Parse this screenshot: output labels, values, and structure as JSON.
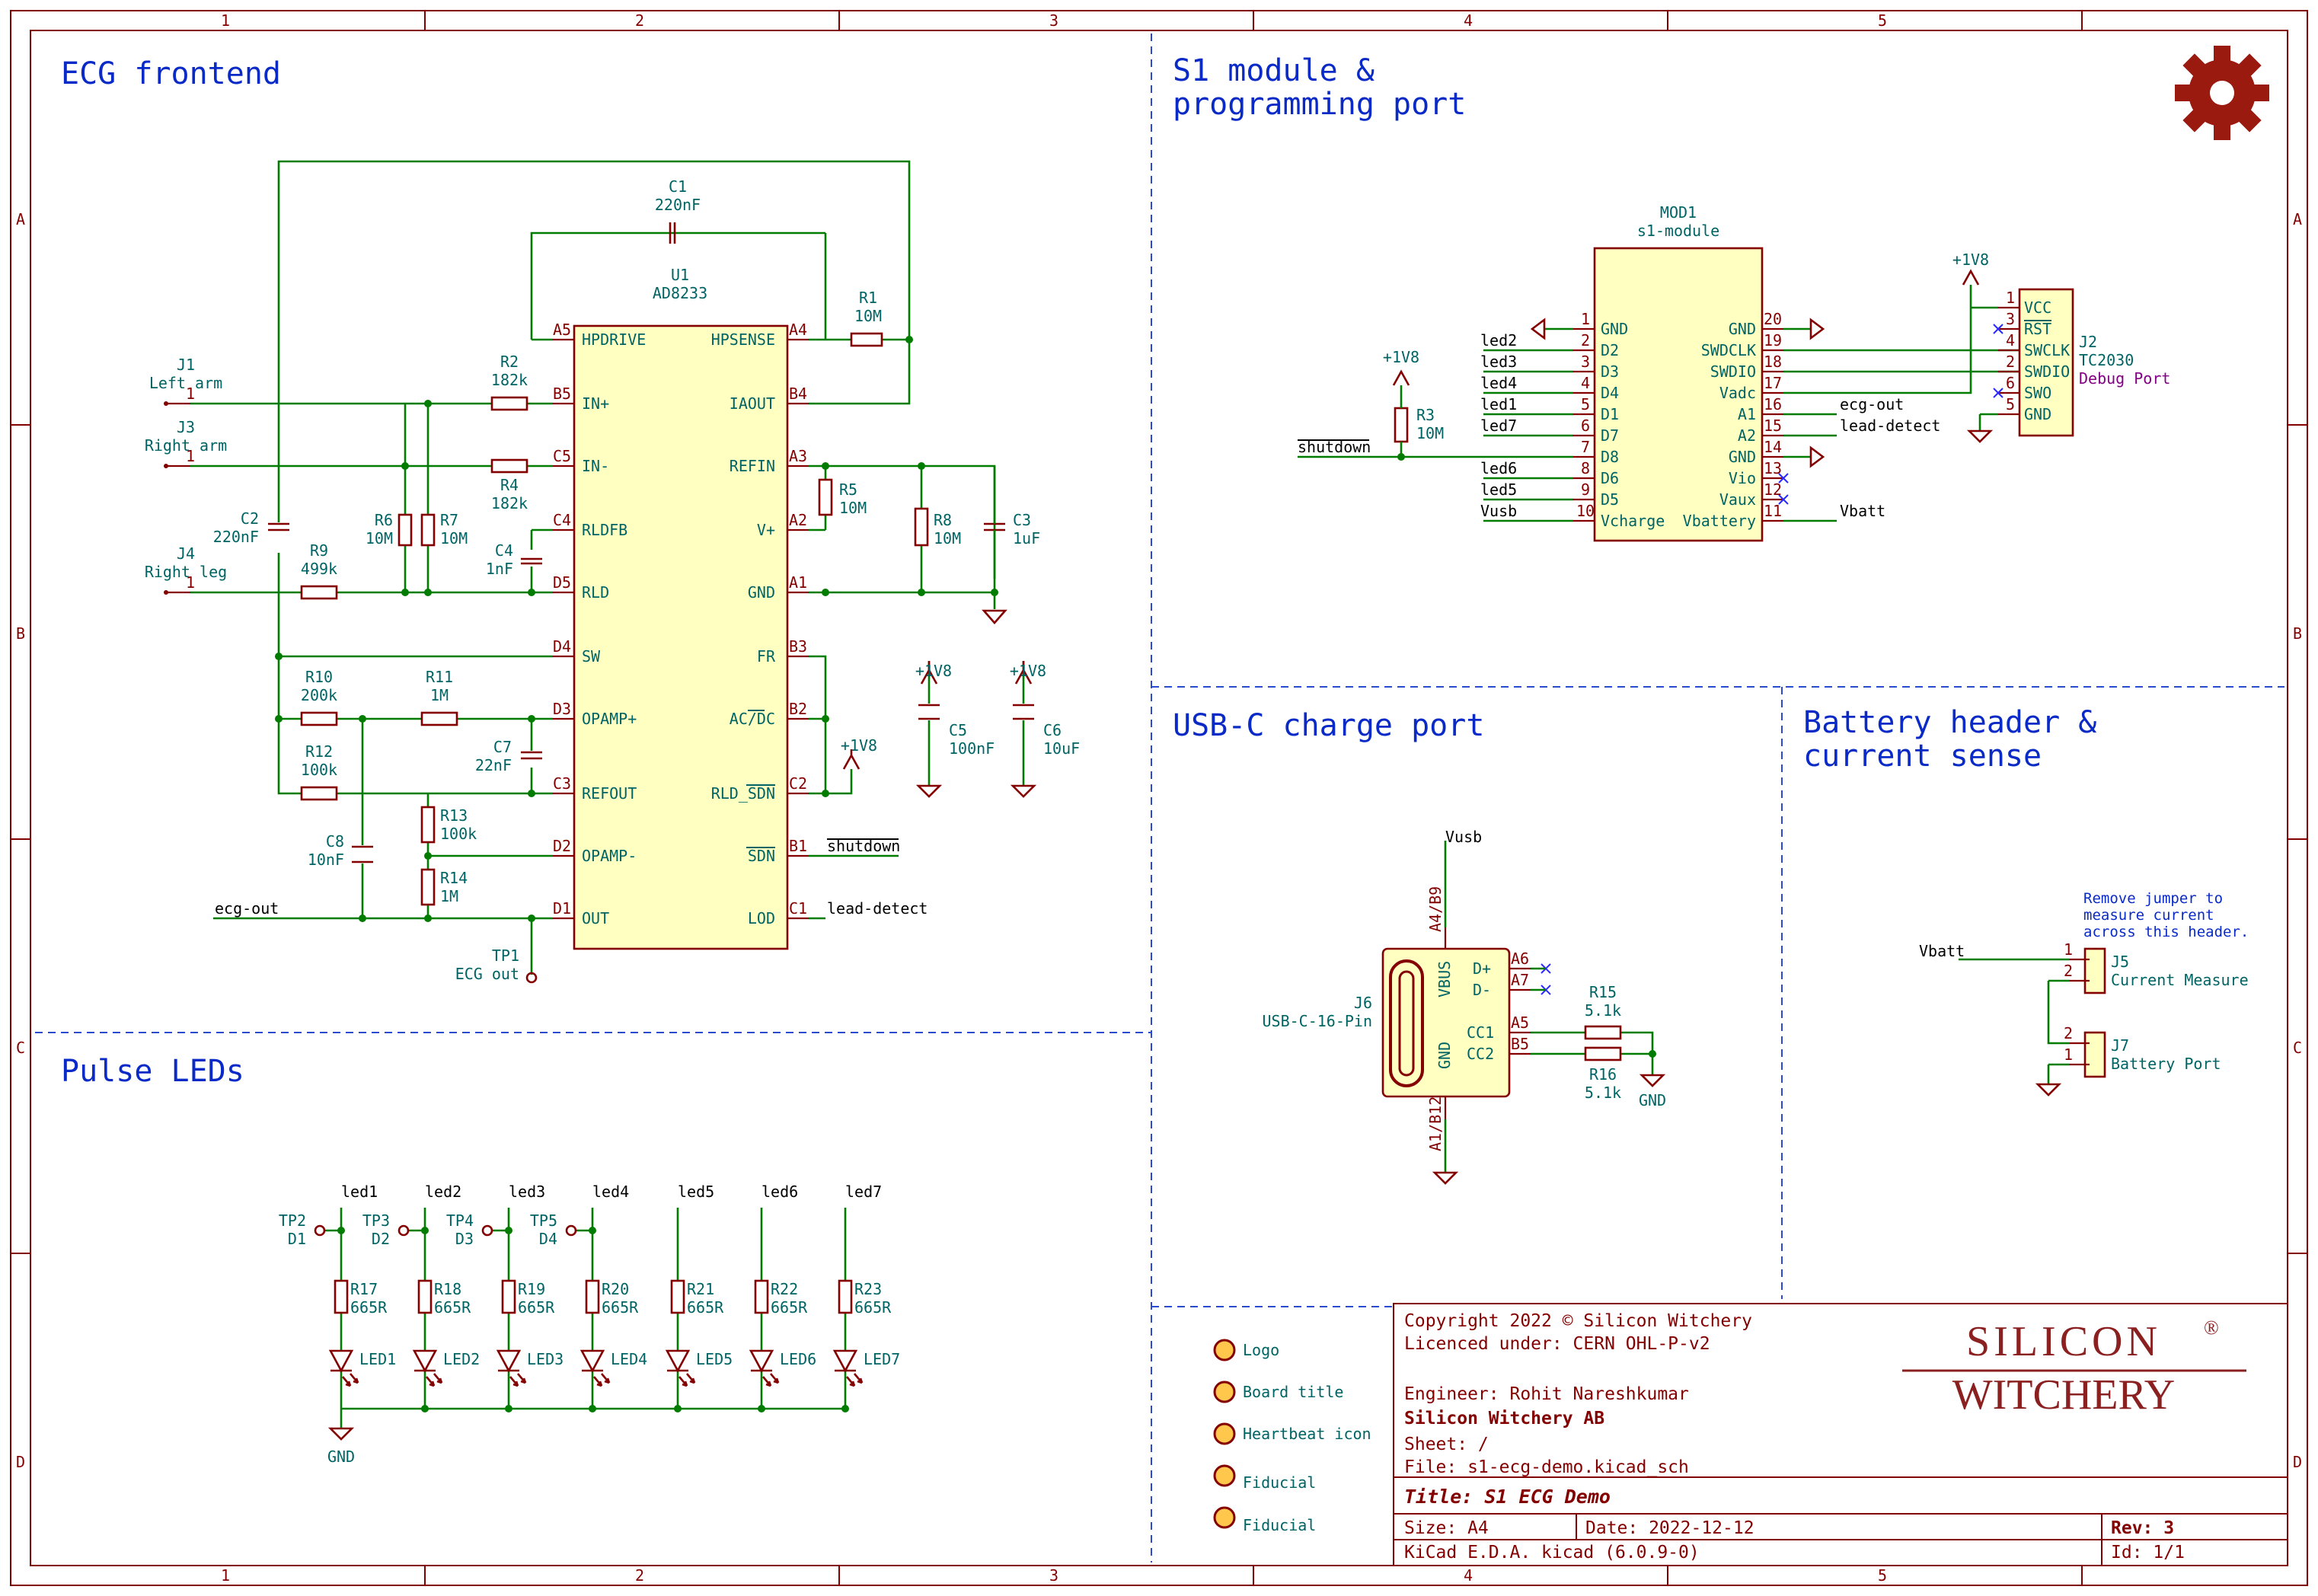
{
  "sections": {
    "ecg": "ECG frontend",
    "s1_line1": "S1 module &",
    "s1_line2": "programming port",
    "pulse": "Pulse LEDs",
    "usb": "USB-C charge port",
    "batt_line1": "Battery header &",
    "batt_line2": "current sense"
  },
  "grid_cols": [
    "1",
    "2",
    "3",
    "4",
    "5"
  ],
  "grid_rows": [
    "A",
    "B",
    "C",
    "D"
  ],
  "u1": {
    "ref": "U1",
    "value": "AD8233",
    "left_pins": [
      {
        "num": "A5",
        "name": "HPDRIVE"
      },
      {
        "num": "B5",
        "name": "IN+"
      },
      {
        "num": "C5",
        "name": "IN-"
      },
      {
        "num": "C4",
        "name": "RLDFB"
      },
      {
        "num": "D5",
        "name": "RLD"
      },
      {
        "num": "D4",
        "name": "SW"
      },
      {
        "num": "D3",
        "name": "OPAMP+"
      },
      {
        "num": "C3",
        "name": "REFOUT"
      },
      {
        "num": "D2",
        "name": "OPAMP-"
      },
      {
        "num": "D1",
        "name": "OUT"
      }
    ],
    "right_pins": [
      {
        "num": "A4",
        "name": "HPSENSE"
      },
      {
        "num": "B4",
        "name": "IAOUT"
      },
      {
        "num": "A3",
        "name": "REFIN"
      },
      {
        "num": "A2",
        "name": "V+"
      },
      {
        "num": "A1",
        "name": "GND"
      },
      {
        "num": "B3",
        "name": "FR"
      },
      {
        "num": "B2",
        "name": "AC/DC"
      },
      {
        "num": "C2",
        "name": "RLD_SDN"
      },
      {
        "num": "B1",
        "name": "SDN"
      },
      {
        "num": "C1",
        "name": "LOD"
      }
    ]
  },
  "ecg_parts": {
    "C1": {
      "ref": "C1",
      "value": "220nF"
    },
    "R1": {
      "ref": "R1",
      "value": "10M"
    },
    "R2": {
      "ref": "R2",
      "value": "182k"
    },
    "R4": {
      "ref": "R4",
      "value": "182k"
    },
    "R5": {
      "ref": "R5",
      "value": "10M"
    },
    "R6": {
      "ref": "R6",
      "value": "10M"
    },
    "R7": {
      "ref": "R7",
      "value": "10M"
    },
    "R8": {
      "ref": "R8",
      "value": "10M"
    },
    "C2": {
      "ref": "C2",
      "value": "220nF"
    },
    "C3": {
      "ref": "C3",
      "value": "1uF"
    },
    "C4": {
      "ref": "C4",
      "value": "1nF"
    },
    "R9": {
      "ref": "R9",
      "value": "499k"
    },
    "R10": {
      "ref": "R10",
      "value": "200k"
    },
    "R11": {
      "ref": "R11",
      "value": "1M"
    },
    "R12": {
      "ref": "R12",
      "value": "100k"
    },
    "C7": {
      "ref": "C7",
      "value": "22nF"
    },
    "R13": {
      "ref": "R13",
      "value": "100k"
    },
    "R14": {
      "ref": "R14",
      "value": "1M"
    },
    "C8": {
      "ref": "C8",
      "value": "10nF"
    },
    "C5": {
      "ref": "C5",
      "value": "100nF"
    },
    "C6": {
      "ref": "C6",
      "value": "10uF"
    },
    "J1": {
      "ref": "J1",
      "value": "Left arm"
    },
    "J3": {
      "ref": "J3",
      "value": "Right arm"
    },
    "J4": {
      "ref": "J4",
      "value": "Right leg"
    },
    "TP1": {
      "ref": "TP1",
      "value": "ECG out"
    },
    "pwr1": "+1V8",
    "pwr2": "+1V8",
    "pwr3": "+1V8",
    "pin1": "1",
    "net_ecg_out": "ecg-out",
    "net_shutdown": "shutdown",
    "net_lead_detect": "lead-detect"
  },
  "mod1": {
    "ref": "MOD1",
    "value": "s1-module",
    "left_pins": [
      {
        "net": "",
        "num": "1",
        "name": "GND"
      },
      {
        "net": "led2",
        "num": "2",
        "name": "D2"
      },
      {
        "net": "led3",
        "num": "3",
        "name": "D3"
      },
      {
        "net": "led4",
        "num": "4",
        "name": "D4"
      },
      {
        "net": "led1",
        "num": "5",
        "name": "D1"
      },
      {
        "net": "led7",
        "num": "6",
        "name": "D7"
      },
      {
        "net": "",
        "num": "7",
        "name": "D8"
      },
      {
        "net": "led6",
        "num": "8",
        "name": "D6"
      },
      {
        "net": "led5",
        "num": "9",
        "name": "D5"
      },
      {
        "net": "Vusb",
        "num": "10",
        "name": "Vcharge"
      }
    ],
    "right_pins": [
      {
        "net": "",
        "num": "20",
        "name": "GND"
      },
      {
        "net": "",
        "num": "19",
        "name": "SWDCLK"
      },
      {
        "net": "",
        "num": "18",
        "name": "SWDIO"
      },
      {
        "net": "",
        "num": "17",
        "name": "Vadc"
      },
      {
        "net": "ecg-out",
        "num": "16",
        "name": "A1"
      },
      {
        "net": "lead-detect",
        "num": "15",
        "name": "A2"
      },
      {
        "net": "",
        "num": "14",
        "name": "GND"
      },
      {
        "net": "",
        "num": "13",
        "name": "Vio"
      },
      {
        "net": "",
        "num": "12",
        "name": "Vaux"
      },
      {
        "net": "Vbatt",
        "num": "11",
        "name": "Vbattery"
      }
    ],
    "r3_ref": "R3",
    "r3_value": "10M",
    "r3_pwr": "+1V8",
    "shutdown": "shutdown"
  },
  "j2": {
    "ref": "J2",
    "value": "TC2030",
    "desc": "Debug Port",
    "pwr": "+1V8",
    "pins": [
      {
        "num": "1",
        "name": "VCC"
      },
      {
        "num": "3",
        "name": "RST"
      },
      {
        "num": "4",
        "name": "SWCLK"
      },
      {
        "num": "2",
        "name": "SWDIO"
      },
      {
        "num": "6",
        "name": "SWO"
      },
      {
        "num": "5",
        "name": "GND"
      }
    ]
  },
  "usb": {
    "ref": "J6",
    "value": "USB-C-16-Pin",
    "net_vusb": "Vusb",
    "gnd": "GND",
    "pin_top": "A4/B9",
    "pin_bottom": "A1/B12",
    "vbus": "VBUS",
    "gndlbl": "GND",
    "dp": "D+",
    "dm": "D-",
    "cc1": "CC1",
    "cc2": "CC2",
    "a6": "A6",
    "a7": "A7",
    "a5": "A5",
    "b5": "B5",
    "r15_ref": "R15",
    "r15_value": "5.1k",
    "r16_ref": "R16",
    "r16_value": "5.1k"
  },
  "battery": {
    "note1": "Remove jumper to",
    "note2": "measure current",
    "note3": "across this header.",
    "vbatt": "Vbatt",
    "j5_ref": "J5",
    "j5_value": "Current Measure",
    "j7_ref": "J7",
    "j7_value": "Battery Port",
    "p1": "1",
    "p2": "2"
  },
  "leds": [
    {
      "net": "led1",
      "r_ref": "R17",
      "r_value": "665R",
      "led": "LED1",
      "tp": "TP2",
      "tp_d": "D1"
    },
    {
      "net": "led2",
      "r_ref": "R18",
      "r_value": "665R",
      "led": "LED2",
      "tp": "TP3",
      "tp_d": "D2"
    },
    {
      "net": "led3",
      "r_ref": "R19",
      "r_value": "665R",
      "led": "LED3",
      "tp": "TP4",
      "tp_d": "D3"
    },
    {
      "net": "led4",
      "r_ref": "R20",
      "r_value": "665R",
      "led": "LED4",
      "tp": "TP5",
      "tp_d": "D4"
    },
    {
      "net": "led5",
      "r_ref": "R21",
      "r_value": "665R",
      "led": "LED5",
      "tp": "",
      "tp_d": ""
    },
    {
      "net": "led6",
      "r_ref": "R22",
      "r_value": "665R",
      "led": "LED6",
      "tp": "",
      "tp_d": ""
    },
    {
      "net": "led7",
      "r_ref": "R23",
      "r_value": "665R",
      "led": "LED7",
      "tp": "",
      "tp_d": ""
    }
  ],
  "led_gnd": "GND",
  "fiducials": [
    "Logo",
    "Board title",
    "Heartbeat icon",
    "Fiducial",
    "Fiducial"
  ],
  "title_block": {
    "copyright": "Copyright 2022 © Silicon Witchery",
    "license": "Licenced under: CERN OHL-P-v2",
    "engineer": "Engineer: Rohit Nareshkumar",
    "company": "Silicon Witchery AB",
    "sheet": "Sheet: /",
    "file": "File: s1-ecg-demo.kicad_sch",
    "title": "Title: S1 ECG Demo",
    "size": "Size: A4",
    "date": "Date: 2022-12-12",
    "rev": "Rev: 3",
    "kicad": "KiCad E.D.A.  kicad (6.0.9-0)",
    "id": "Id: 1/1",
    "logo_line1": "SILICON",
    "logo_reg": "®",
    "logo_line2": "WITCHERY"
  },
  "colors": {
    "frame": "#840000",
    "wire": "#007c00",
    "section": "#0a2ac8",
    "body": "#ffffc2"
  }
}
